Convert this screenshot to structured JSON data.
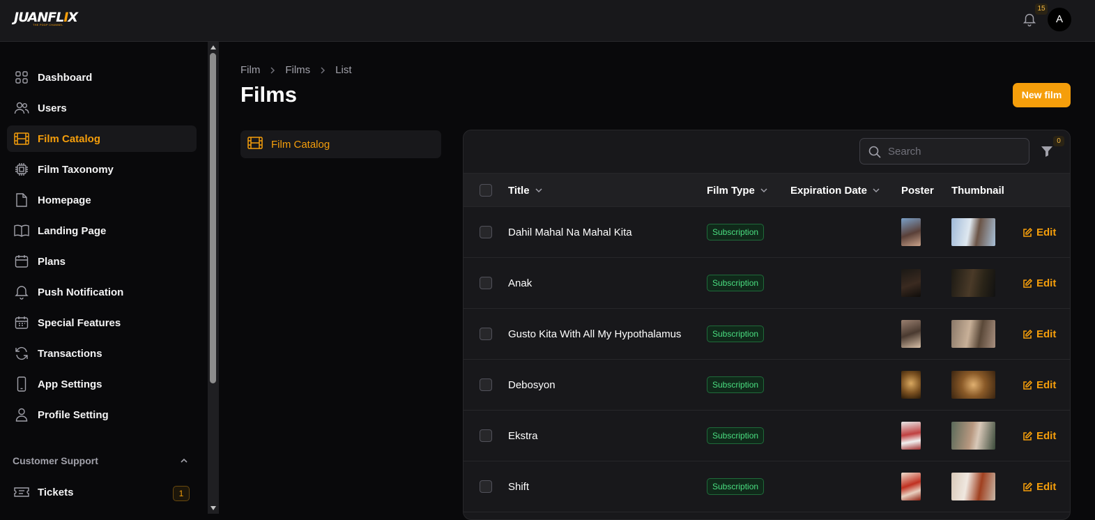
{
  "app": {
    "logo_text": "JUANFLIX",
    "logo_tagline": "THE PDDP CHANNEL"
  },
  "header": {
    "notifications_count": "15",
    "avatar_initial": "A"
  },
  "sidebar": {
    "items": [
      {
        "label": "Dashboard",
        "icon": "dashboard-icon"
      },
      {
        "label": "Users",
        "icon": "users-icon"
      },
      {
        "label": "Film Catalog",
        "icon": "film-icon",
        "active": true
      },
      {
        "label": "Film Taxonomy",
        "icon": "taxonomy-icon"
      },
      {
        "label": "Homepage",
        "icon": "document-icon"
      },
      {
        "label": "Landing Page",
        "icon": "book-icon"
      },
      {
        "label": "Plans",
        "icon": "calendar-icon"
      },
      {
        "label": "Push Notification",
        "icon": "bell-icon"
      },
      {
        "label": "Special Features",
        "icon": "calendar-grid-icon"
      },
      {
        "label": "Transactions",
        "icon": "refresh-icon"
      },
      {
        "label": "App Settings",
        "icon": "phone-icon"
      },
      {
        "label": "Profile Setting",
        "icon": "user-icon"
      }
    ],
    "group": {
      "label": "Customer Support"
    },
    "tickets": {
      "label": "Tickets",
      "badge": "1"
    }
  },
  "breadcrumb": [
    "Film",
    "Films",
    "List"
  ],
  "page": {
    "title": "Films",
    "new_button": "New film"
  },
  "subnav": {
    "label": "Film Catalog"
  },
  "table": {
    "search_placeholder": "Search",
    "filter_count": "0",
    "columns": {
      "title": "Title",
      "film_type": "Film Type",
      "expiration": "Expiration Date",
      "poster": "Poster",
      "thumbnail": "Thumbnail"
    },
    "edit_label": "Edit",
    "rows": [
      {
        "title": "Dahil Mahal Na Mahal Kita",
        "type": "Subscription"
      },
      {
        "title": "Anak",
        "type": "Subscription"
      },
      {
        "title": "Gusto Kita With All My Hypothalamus",
        "type": "Subscription"
      },
      {
        "title": "Debosyon",
        "type": "Subscription"
      },
      {
        "title": "Ekstra",
        "type": "Subscription"
      },
      {
        "title": "Shift",
        "type": "Subscription"
      }
    ]
  },
  "colors": {
    "accent": "#f59e0b",
    "background": "#09090b",
    "panel": "#18181b",
    "success": "#4ade80"
  }
}
